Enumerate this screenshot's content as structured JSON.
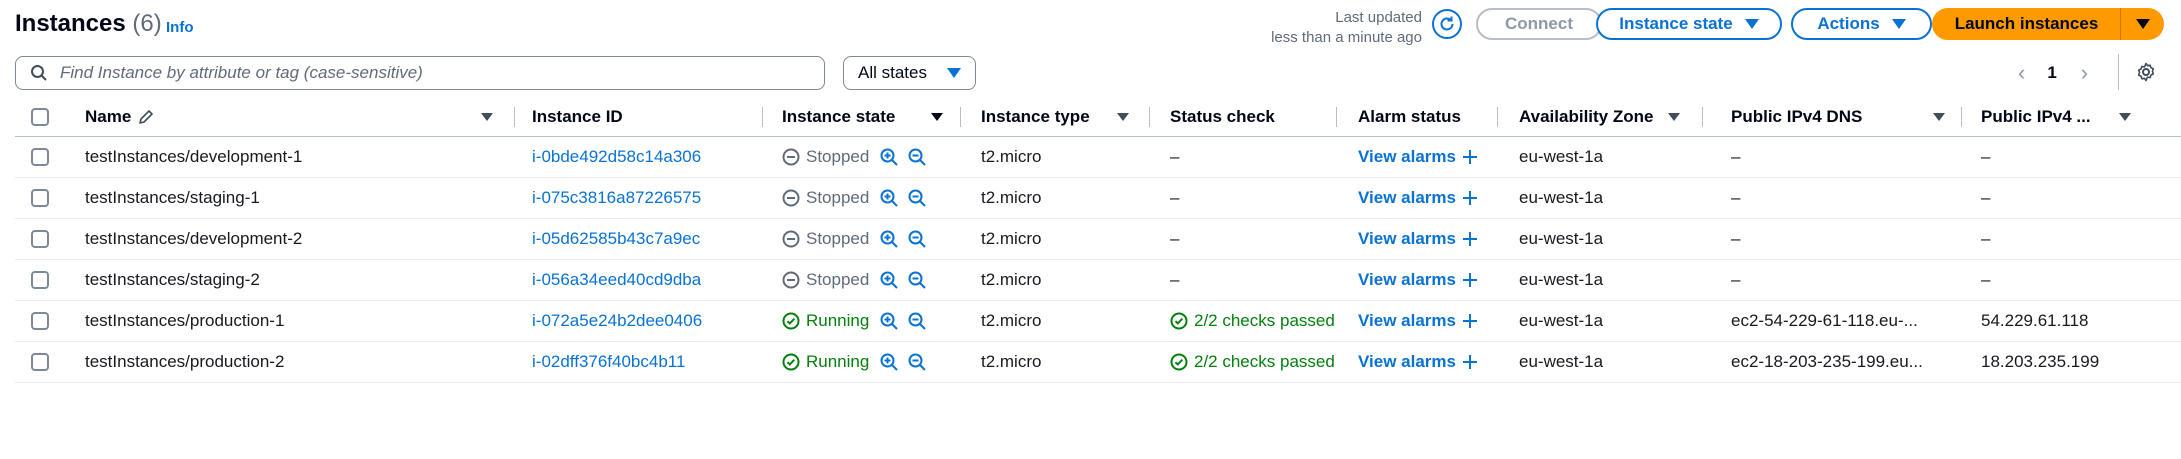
{
  "header": {
    "title": "Instances",
    "count": "(6)",
    "info_label": "Info",
    "last_updated_line1": "Last updated",
    "last_updated_line2": "less than a minute ago",
    "connect_label": "Connect",
    "instance_state_label": "Instance state",
    "actions_label": "Actions",
    "launch_label": "Launch instances"
  },
  "search": {
    "placeholder": "Find Instance by attribute or tag (case-sensitive)",
    "states_label": "All states"
  },
  "pagination": {
    "current_page": "1"
  },
  "columns": {
    "name": "Name",
    "instance_id": "Instance ID",
    "instance_state": "Instance state",
    "instance_type": "Instance type",
    "status_check": "Status check",
    "alarm_status": "Alarm status",
    "availability_zone": "Availability Zone",
    "public_dns": "Public IPv4 DNS",
    "public_ip": "Public IPv4 ..."
  },
  "rows": [
    {
      "name": "testInstances/development-1",
      "id": "i-0bde492d58c14a306",
      "state": "Stopped",
      "type": "t2.micro",
      "status": "–",
      "alarm": "View alarms",
      "az": "eu-west-1a",
      "dns": "–",
      "ip": "–"
    },
    {
      "name": "testInstances/staging-1",
      "id": "i-075c3816a87226575",
      "state": "Stopped",
      "type": "t2.micro",
      "status": "–",
      "alarm": "View alarms",
      "az": "eu-west-1a",
      "dns": "–",
      "ip": "–"
    },
    {
      "name": "testInstances/development-2",
      "id": "i-05d62585b43c7a9ec",
      "state": "Stopped",
      "type": "t2.micro",
      "status": "–",
      "alarm": "View alarms",
      "az": "eu-west-1a",
      "dns": "–",
      "ip": "–"
    },
    {
      "name": "testInstances/staging-2",
      "id": "i-056a34eed40cd9dba",
      "state": "Stopped",
      "type": "t2.micro",
      "status": "–",
      "alarm": "View alarms",
      "az": "eu-west-1a",
      "dns": "–",
      "ip": "–"
    },
    {
      "name": "testInstances/production-1",
      "id": "i-072a5e24b2dee0406",
      "state": "Running",
      "type": "t2.micro",
      "status": "2/2 checks passed",
      "alarm": "View alarms",
      "az": "eu-west-1a",
      "dns": "ec2-54-229-61-118.eu-...",
      "ip": "54.229.61.118"
    },
    {
      "name": "testInstances/production-2",
      "id": "i-02dff376f40bc4b11",
      "state": "Running",
      "type": "t2.micro",
      "status": "2/2 checks passed",
      "alarm": "View alarms",
      "az": "eu-west-1a",
      "dns": "ec2-18-203-235-199.eu...",
      "ip": "18.203.235.199"
    }
  ],
  "colors": {
    "link": "#0972d3",
    "running": "#037f0c",
    "stopped": "#5f6b7a",
    "primary": "#ff9900"
  },
  "icons": [
    "search-icon",
    "refresh-icon",
    "pencil-icon",
    "settings-icon",
    "chevron-left-icon",
    "chevron-right-icon",
    "zoom-in-icon",
    "zoom-out-icon",
    "stopped-icon",
    "running-icon",
    "check-passed-icon",
    "plus-icon",
    "caret-down-icon"
  ]
}
